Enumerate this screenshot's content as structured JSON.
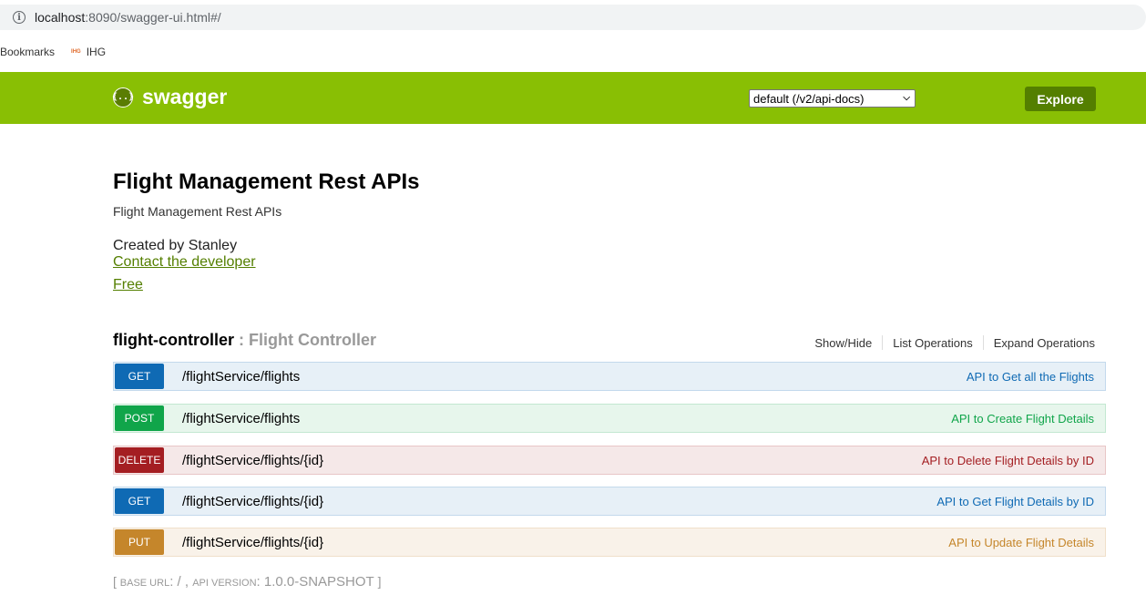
{
  "browser": {
    "url_host": "localhost",
    "url_rest": ":8090/swagger-ui.html#/",
    "bookmarks": [
      {
        "label": "Bookmarks"
      },
      {
        "label": "IHG"
      }
    ],
    "ihg_logo_text": "IHG"
  },
  "header": {
    "logo_icon_text": "{..}",
    "logo_text": "swagger",
    "spec_select_value": "default (/v2/api-docs)",
    "explore_label": "Explore",
    "colors": {
      "bar": "#89bf04",
      "explore": "#547f00"
    }
  },
  "info": {
    "title": "Flight Management Rest APIs",
    "description": "Flight Management Rest APIs",
    "created_by": "Created by Stanley",
    "contact_link": "Contact the developer",
    "license_link": "Free"
  },
  "resource": {
    "name": "flight-controller",
    "separator": " : ",
    "description": "Flight Controller",
    "actions": {
      "show_hide": "Show/Hide",
      "list_operations": "List Operations",
      "expand_operations": "Expand Operations"
    },
    "operations": [
      {
        "method": "GET",
        "path": "/flightService/flights",
        "summary": "API to Get all the Flights"
      },
      {
        "method": "POST",
        "path": "/flightService/flights",
        "summary": "API to Create Flight Details"
      },
      {
        "method": "DELETE",
        "path": "/flightService/flights/{id}",
        "summary": "API to Delete Flight Details by ID"
      },
      {
        "method": "GET",
        "path": "/flightService/flights/{id}",
        "summary": "API to Get Flight Details by ID"
      },
      {
        "method": "PUT",
        "path": "/flightService/flights/{id}",
        "summary": "API to Update Flight Details"
      }
    ]
  },
  "footer": {
    "open": "[ ",
    "base_url_label": "Base url",
    "base_url_value": ": / , ",
    "api_version_label": "api version",
    "api_version_value": ": 1.0.0-SNAPSHOT",
    "close": " ]"
  }
}
